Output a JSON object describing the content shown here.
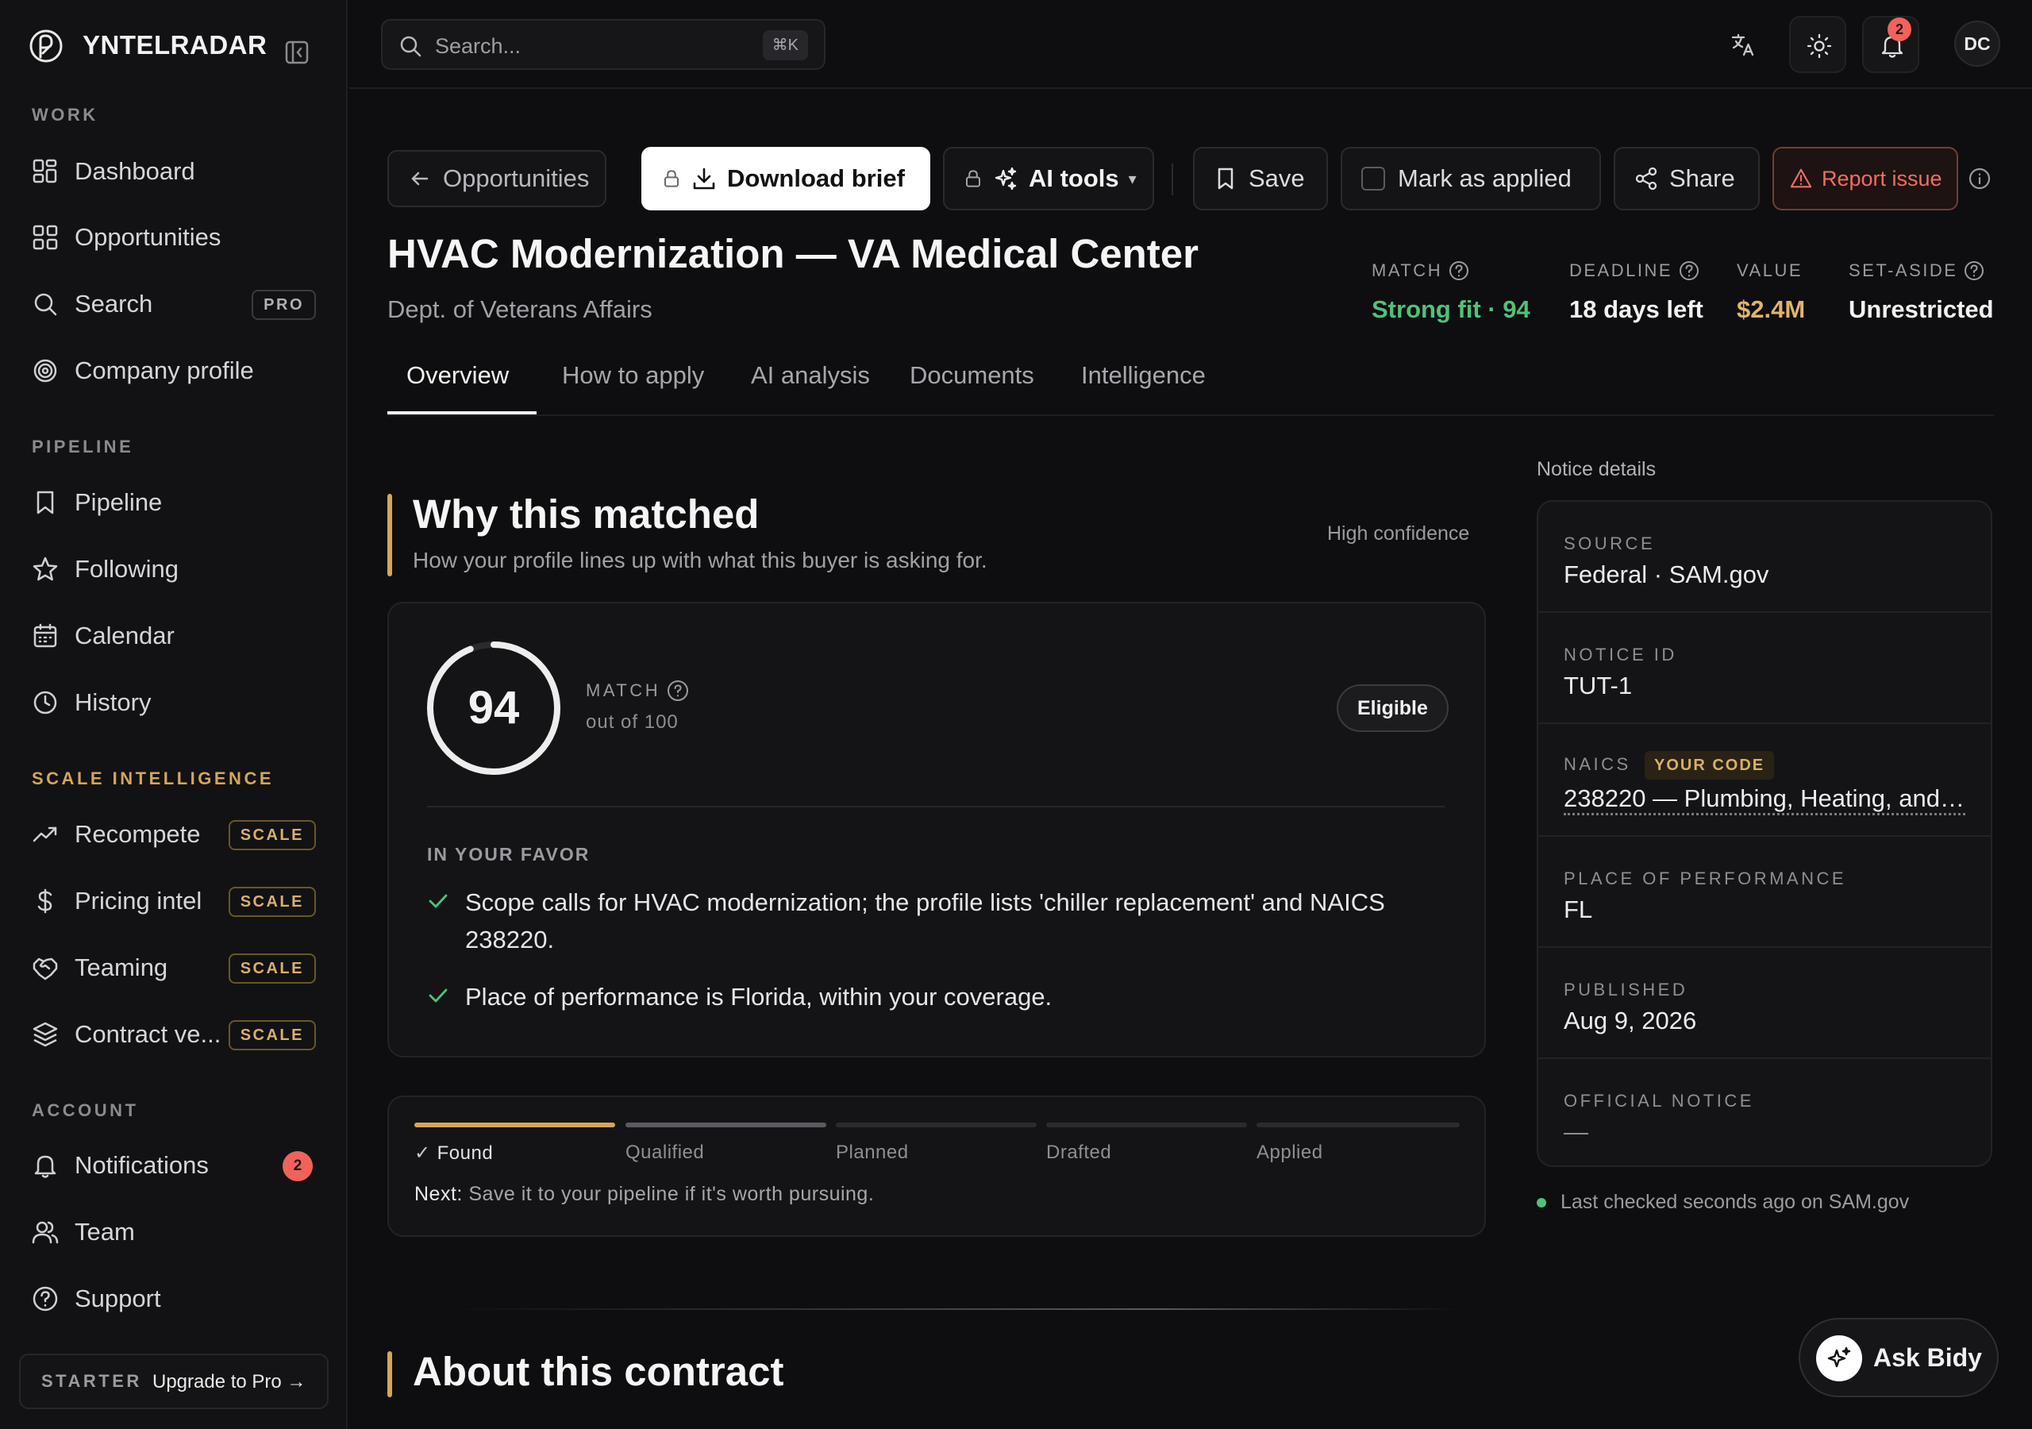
{
  "app": {
    "brand": "YNTELRADAR"
  },
  "sidebar": {
    "sections": {
      "work": "WORK",
      "pipeline": "PIPELINE",
      "scale": "SCALE INTELLIGENCE",
      "account": "ACCOUNT"
    },
    "items": {
      "dashboard": "Dashboard",
      "opportunities": "Opportunities",
      "search": "Search",
      "search_badge": "PRO",
      "company_profile": "Company profile",
      "pipeline": "Pipeline",
      "following": "Following",
      "calendar": "Calendar",
      "history": "History",
      "recompete": "Recompete",
      "pricing_intel": "Pricing intel",
      "teaming": "Teaming",
      "contract_vehicles": "Contract ve...",
      "scale_badge": "SCALE",
      "notifications": "Notifications",
      "notifications_count": "2",
      "team": "Team",
      "support": "Support"
    },
    "plan": {
      "name": "STARTER",
      "cta": "Upgrade to Pro →"
    }
  },
  "topbar": {
    "search_placeholder": "Search...",
    "search_shortcut": "⌘K",
    "notification_count": "2",
    "user_initials": "DC"
  },
  "actions": {
    "back": "Opportunities",
    "download": "Download brief",
    "ai_tools": "AI tools",
    "ai_tools_caret": "▾",
    "save": "Save",
    "mark_applied": "Mark as applied",
    "share": "Share",
    "report": "Report issue"
  },
  "opportunity": {
    "title": "HVAC Modernization — VA Medical Center",
    "agency": "Dept. of Veterans Affairs",
    "stats": {
      "match_label": "MATCH",
      "match_value": "Strong fit · 94",
      "deadline_label": "DEADLINE",
      "deadline_value": "18 days left",
      "value_label": "VALUE",
      "value_value": "$2.4M",
      "setaside_label": "SET-ASIDE",
      "setaside_value": "Unrestricted"
    }
  },
  "tabs": [
    "Overview",
    "How to apply",
    "AI analysis",
    "Documents",
    "Intelligence"
  ],
  "why_matched": {
    "title": "Why this matched",
    "subtitle": "How your profile lines up with what this buyer is asking for.",
    "confidence": "High confidence",
    "score": "94",
    "score_fraction": 0.94,
    "match_label": "MATCH",
    "out_of": "out of 100",
    "eligibility": "Eligible",
    "favor_label": "IN YOUR FAVOR",
    "favor_items": [
      "Scope calls for HVAC modernization; the profile lists 'chiller replacement' and NAICS 238220.",
      "Place of performance is Florida, within your coverage."
    ]
  },
  "progress": {
    "steps": [
      "Found",
      "Qualified",
      "Planned",
      "Drafted",
      "Applied"
    ],
    "check": "✓",
    "next_label": "Next:",
    "next_text": "Save it to your pipeline if it's worth pursuing."
  },
  "about": {
    "title": "About this contract"
  },
  "notice": {
    "title": "Notice details",
    "source_label": "SOURCE",
    "source": "Federal · SAM.gov",
    "id_label": "NOTICE ID",
    "id": "TUT-1",
    "naics_label": "NAICS",
    "naics_badge": "YOUR CODE",
    "naics": "238220 — Plumbing, Heating, and ...",
    "pop_label": "PLACE OF PERFORMANCE",
    "pop": "FL",
    "published_label": "PUBLISHED",
    "published": "Aug 9, 2026",
    "official_label": "OFFICIAL NOTICE",
    "official": "—",
    "last_checked": "Last checked seconds ago on SAM.gov"
  },
  "assistant": {
    "label": "Ask Bidy"
  },
  "colors": {
    "accent_gold": "#d4a65a",
    "match_green": "#4ec27a",
    "value_gold": "#e0b36a",
    "danger": "#f26d5f",
    "badge_red": "#f0625a"
  }
}
